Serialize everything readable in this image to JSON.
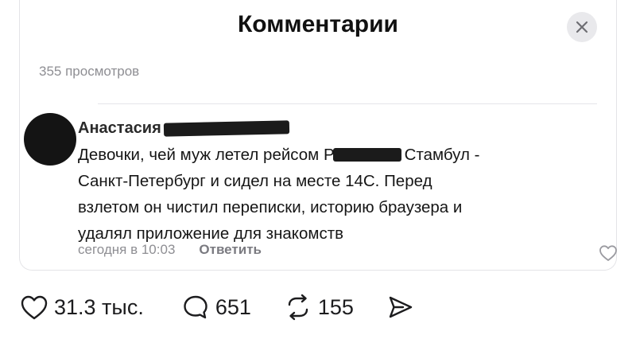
{
  "header": {
    "title": "Комментарии"
  },
  "stats": {
    "views": "355 просмотров"
  },
  "comment": {
    "author": "Анастасия",
    "lines": [
      {
        "before": "Девочки, чей муж летел рейсом Р",
        "after": "Стамбул -"
      },
      {
        "text": "Санкт-Петербург и сидел на месте 14С. Перед"
      },
      {
        "text": "взлетом он чистил переписки, историю браузера и"
      },
      {
        "text": "удалял приложение для знакомств"
      }
    ],
    "time": "сегодня в 10:03",
    "reply_label": "Ответить"
  },
  "post_actions": {
    "likes": "31.3 тыс.",
    "comments": "651",
    "reposts": "155"
  },
  "colors": {
    "text": "#1a1a1a",
    "muted": "#8e8e93",
    "redaction": "#1b1b1b"
  }
}
